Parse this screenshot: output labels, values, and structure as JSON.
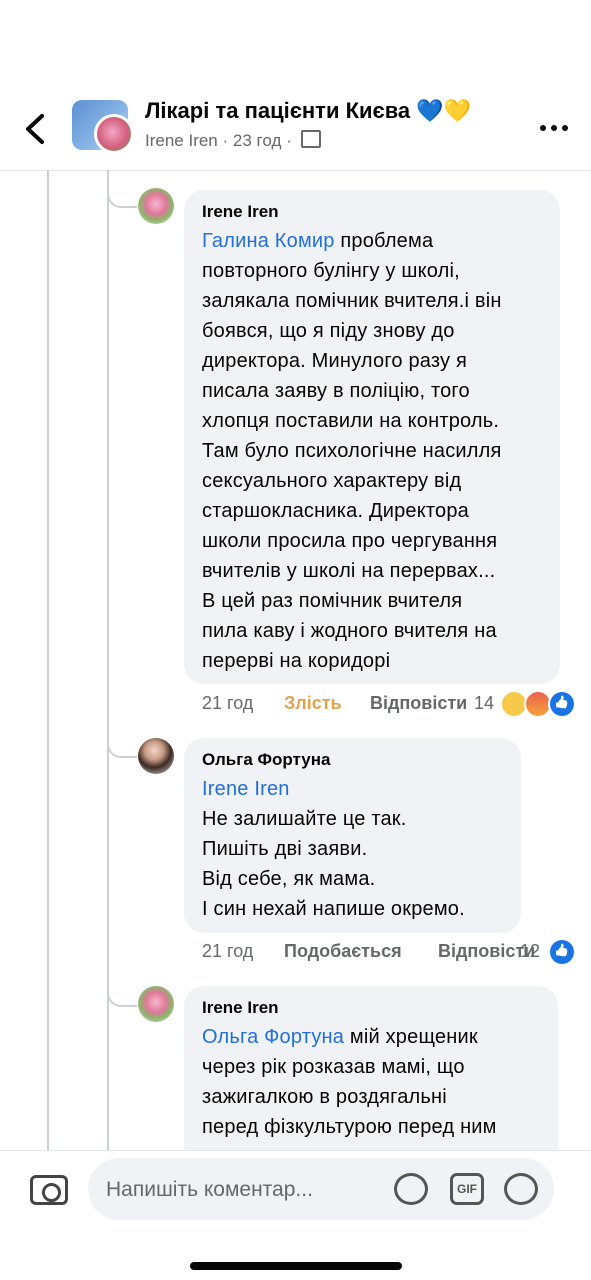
{
  "header": {
    "group_title": "Лікарі та пацієнти Києва 💙💛",
    "author": "Irene Iren",
    "time": "23 год",
    "dot": "·"
  },
  "comments": [
    {
      "author": "Irene Iren",
      "mention": "Галина Комир",
      "lines": [
        " проблема",
        "повторного булінгу у школі,",
        "залякала помічник вчителя.і він",
        "боявся, що я піду знову до",
        "директора. Минулого разу я",
        "писала заяву в поліцію, того",
        "хлопця поставили на контроль.",
        "Там було психологічне насилля",
        "сексуального характеру від",
        "старшокласника. Директора",
        "школи просила про чергування",
        "вчителів у школі на перервах...",
        "В цей раз помічник вчителя",
        "пила каву і жодного вчителя на",
        "перерві на коридорі"
      ],
      "time": "21 год",
      "reaction_label": "Злість",
      "reply_label": "Відповісти",
      "reaction_count": "14"
    },
    {
      "author": "Ольга Фортуна",
      "mention": "Irene Iren",
      "lines": [
        "Не залишайте це так.",
        "Пишіть дві заяви.",
        "Від себе, як мама.",
        "І син нехай напише окремо."
      ],
      "time": "21 год",
      "reaction_label": "Подобається",
      "reply_label": "Відповісти",
      "reaction_count": "12"
    },
    {
      "author": "Irene Iren",
      "mention": "Ольга Фортуна",
      "lines": [
        " мій хрещеник",
        "через рік розказав мамі, що",
        "зажигалкою в роздягальні",
        "перед фізкультурою перед ним"
      ]
    }
  ],
  "composer": {
    "placeholder": "Напишіть коментар...",
    "gif_label": "GIF"
  },
  "icons": [
    "back-arrow-icon",
    "more-icon",
    "members-icon",
    "camera-icon",
    "avatar-sticker-icon",
    "gif-icon",
    "emoji-icon",
    "sad-reaction-icon",
    "angry-reaction-icon",
    "like-reaction-icon"
  ]
}
